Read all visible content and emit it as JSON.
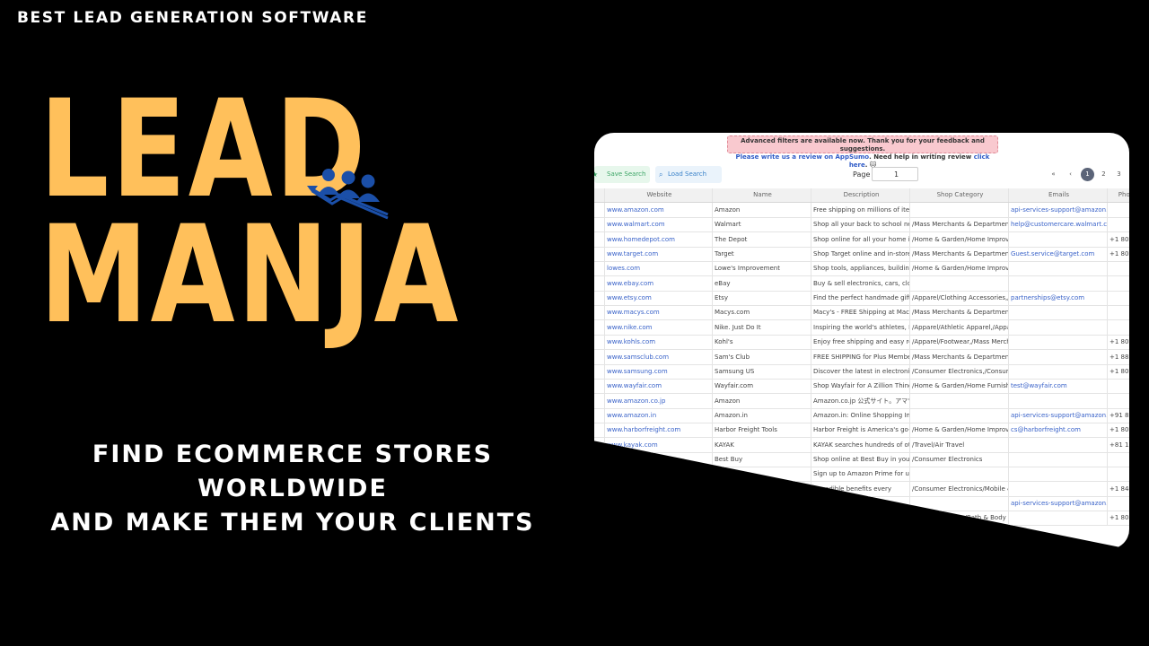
{
  "tagline": "BEST LEAD GENERATION SOFTWARE",
  "logo": {
    "line1": "LEAD",
    "line2": "MANJA",
    "mark_icon": "team-growth-icon",
    "color": "#ffc05b"
  },
  "headline": {
    "line1": "FIND ECOMMERCE STORES WORLDWIDE",
    "line2": "AND MAKE THEM YOUR CLIENTS"
  },
  "app": {
    "notice_line1": "Advanced filters are available now. Thank you for your feedback and suggestions.",
    "notice_line2a": "Please write us a review on ",
    "notice_link1": "AppSumo",
    "notice_line2b": ". Need help in writing review ",
    "notice_link2": "click here",
    "notice_emoji": ". 🐱",
    "save_search_label": "Save Search",
    "load_search_label": "Load Search",
    "page_label": "Page",
    "page_value": "1",
    "pager_first": "«",
    "pager_prev": "‹",
    "pages": [
      "1",
      "2",
      "3"
    ],
    "columns": [
      "Website",
      "Name",
      "Description",
      "Shop Category",
      "Emails",
      "Phon"
    ],
    "rows": [
      [
        "www.amazon.com",
        "Amazon",
        "Free shipping on millions of items",
        "",
        "api-services-support@amazon.c",
        ""
      ],
      [
        "www.walmart.com",
        "Walmart",
        "Shop all your back to school nee",
        "/Mass Merchants & Department",
        "help@customercare.walmart.co",
        ""
      ],
      [
        "www.homedepot.com",
        "The Depot",
        "Shop online for all your home imp",
        "/Home & Garden/Home Improve",
        "",
        "+1 800"
      ],
      [
        "www.target.com",
        "Target",
        "Shop Target online and in-store",
        "/Mass Merchants & Department",
        "Guest.service@target.com",
        "+1 800"
      ],
      [
        "lowes.com",
        "Lowe's Improvement",
        "Shop tools, appliances, building s",
        "/Home & Garden/Home Improve",
        "",
        ""
      ],
      [
        "www.ebay.com",
        "eBay",
        "Buy & sell electronics, cars, clothe",
        "",
        "",
        ""
      ],
      [
        "www.etsy.com",
        "Etsy",
        "Find the perfect handmade gift, v",
        "/Apparel/Clothing Accessories,/A",
        "partnerships@etsy.com",
        ""
      ],
      [
        "www.macys.com",
        "Macys.com",
        "Macy's - FREE Shipping at Macys.",
        "/Mass Merchants & Department",
        "",
        ""
      ],
      [
        "www.nike.com",
        "Nike. Just Do It",
        "Inspiring the world's athletes, Nik",
        "/Apparel/Athletic Apparel,/Appa",
        "",
        ""
      ],
      [
        "www.kohls.com",
        "Kohl's",
        "Enjoy free shipping and easy retu",
        "/Apparel/Footwear,/Mass Merch",
        "",
        "+1 801-"
      ],
      [
        "www.samsclub.com",
        "Sam's Club",
        "FREE SHIPPING for Plus Members.",
        "/Mass Merchants & Department",
        "",
        "+1 888"
      ],
      [
        "www.samsung.com",
        "Samsung US",
        "Discover the latest in electronic &",
        "/Consumer Electronics,/Consum",
        "",
        "+1 800"
      ],
      [
        "www.wayfair.com",
        "Wayfair.com",
        "Shop Wayfair for A Zillion Things H",
        "/Home & Garden/Home Furnishi",
        "test@wayfair.com",
        ""
      ],
      [
        "www.amazon.co.jp",
        "Amazon",
        "Amazon.co.jp 公式サイト。アマゾ",
        "",
        "",
        ""
      ],
      [
        "www.amazon.in",
        "Amazon.in",
        "Amazon.in: Online Shopping India",
        "",
        "api-services-support@amazon.c",
        "+91 88"
      ],
      [
        "www.harborfreight.com",
        "Harbor Freight Tools",
        "Harbor Freight is America's go-to",
        "/Home & Garden/Home Improve",
        "cs@harborfreight.com",
        "+1 800"
      ],
      [
        "www.kayak.com",
        "KAYAK",
        "KAYAK searches hundreds of othe",
        "/Travel/Air Travel",
        "",
        "+81 11-"
      ],
      [
        "www.bestbuy.com",
        "Best Buy",
        "Shop online at Best Buy in your c",
        "/Consumer Electronics",
        "",
        ""
      ],
      [
        "",
        "",
        "Sign up to Amazon Prime for unlim",
        "",
        "",
        ""
      ],
      [
        "",
        "",
        "Incredible benefits every",
        "/Consumer Electronics/Mobile &",
        "",
        "+1 844"
      ],
      [
        "",
        "",
        "",
        "",
        "api-services-support@amazon.c",
        ""
      ],
      [
        "",
        "",
        "",
        "/Home & Garden/Bath & Body C",
        "",
        "+1 800"
      ]
    ]
  }
}
